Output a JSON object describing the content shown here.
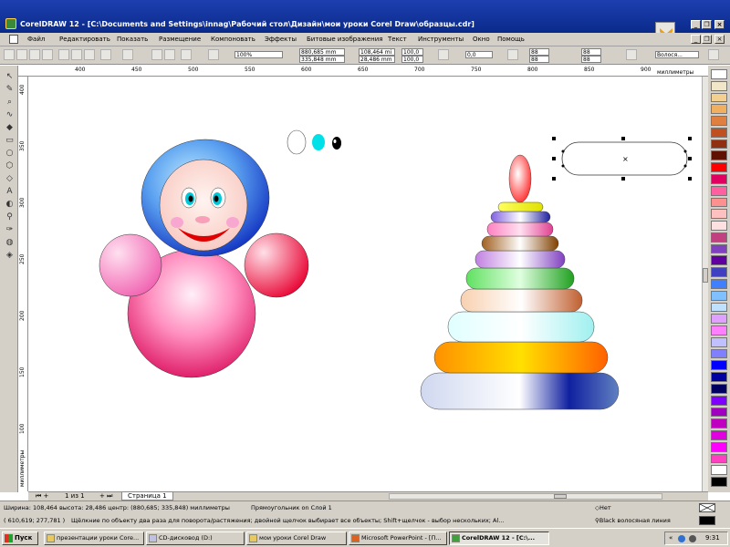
{
  "window": {
    "title": "CorelDRAW 12 - [C:\\Documents and Settings\\innag\\Рабочий стол\\Дизайн\\мои уроки Corel Draw\\образцы.cdr]",
    "minimize": "_",
    "restore": "❐",
    "close": "×",
    "doc_minimize": "_",
    "doc_restore": "❐",
    "doc_close": "×"
  },
  "menu": {
    "items": [
      "Файл",
      "Редактировать",
      "Показать",
      "Размещение",
      "Компоновать",
      "Эффекты",
      "Битовые изображения",
      "Текст",
      "Инструменты",
      "Окно",
      "Помощь"
    ]
  },
  "propbar": {
    "zoom": "100%",
    "x": "880,685 mm",
    "y": "335,848 mm",
    "width": "108,464 mi",
    "height": "28,486 mm",
    "scale_x": "100,0",
    "scale_y": "100,0",
    "percent": "%",
    "angle": "0,0",
    "corner_1": "88",
    "corner_2": "88",
    "corner_3": "88",
    "corner_4": "88",
    "outline": "Волося..."
  },
  "ruler": {
    "h_labels": [
      "400",
      "450",
      "500",
      "550",
      "600",
      "650",
      "700",
      "750",
      "800",
      "850",
      "900"
    ],
    "h_unit": "миллиметры",
    "v_labels": [
      "400",
      "350",
      "300",
      "250",
      "200",
      "150",
      "100"
    ],
    "v_unit": "миллиметры"
  },
  "pages": {
    "counter": "1 из 1",
    "tab": "Страница 1"
  },
  "status": {
    "line1": "Ширина: 108,464  высота: 28,486  центр: (880,685; 335,848)  миллиметры",
    "object": "Прямоугольник on Слой 1",
    "coords": "( 610,619; 277,781 )",
    "hint": "Щёлкние по объекту два раза для поворота/растяжения; двойной щелчок выбирает все объекты; Shift+щелчок - выбор нескольких; Al...",
    "fill": "Нет",
    "outline": "Black  волосяная линия"
  },
  "taskbar": {
    "start": "Пуск",
    "tasks": [
      "презентации уроки Core...",
      "CD-дисковод (D:)",
      "мои уроки Corel Draw",
      "Microsoft PowerPoint - [П...",
      "CorelDRAW 12 - [C:\\..."
    ],
    "clock": "9:31"
  },
  "colors": {
    "titlebar": "#1d3fb0",
    "chrome": "#d4d0c8",
    "palette": [
      "#ffffff",
      "#f2e6c8",
      "#f4d090",
      "#f0b060",
      "#e08040",
      "#c05020",
      "#903010",
      "#601000",
      "#ff0000",
      "#e00060",
      "#ff60a0",
      "#ff9090",
      "#ffc0c0",
      "#ffe0e0",
      "#c04080",
      "#8040c0",
      "#6000a0",
      "#4040c0",
      "#4080ff",
      "#80c0ff",
      "#c0e0ff",
      "#e0a0ff",
      "#ff80ff",
      "#c0c0ff",
      "#8080ff",
      "#0000ff",
      "#0000a0",
      "#000060",
      "#8000ff",
      "#a000c0",
      "#c000c0",
      "#e000e0",
      "#ff00ff",
      "#ff40c0",
      "#ffffff",
      "#000000"
    ]
  }
}
